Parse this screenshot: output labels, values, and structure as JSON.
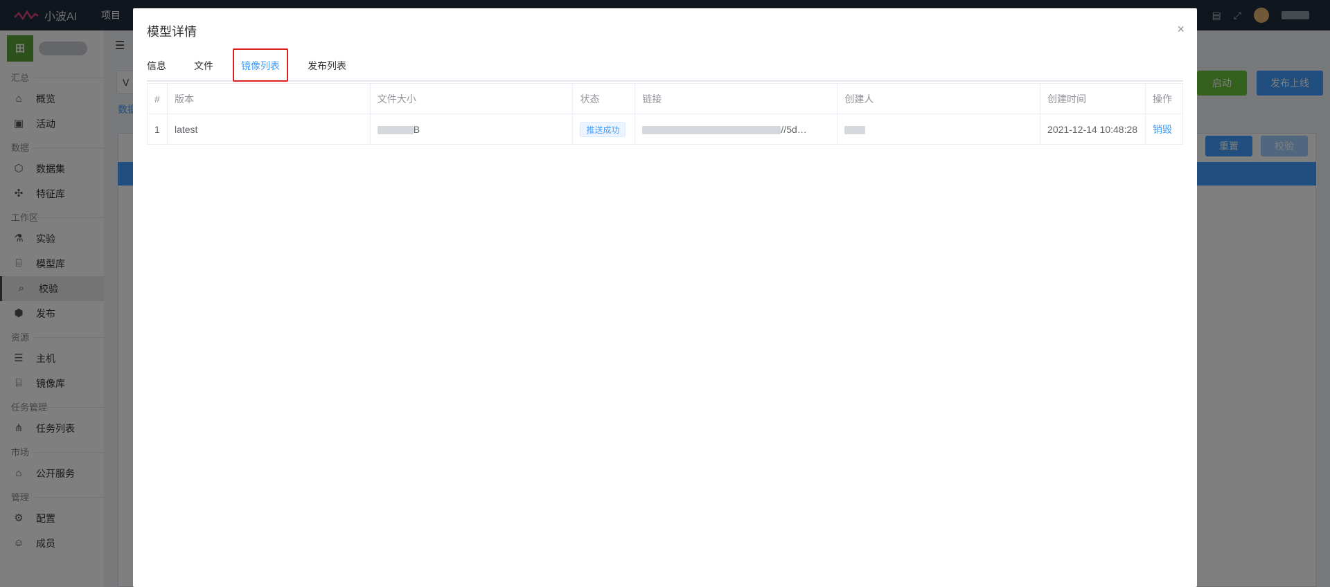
{
  "topbar": {
    "brand": "小波AI",
    "menu_project": "项目"
  },
  "sidebar": {
    "project_icon_text": "田",
    "sections": {
      "summary": "汇总",
      "data": "数据",
      "workspace": "工作区",
      "resources": "资源",
      "tasks": "任务管理",
      "market": "市场",
      "manage": "管理"
    },
    "items": {
      "overview": "概览",
      "activity": "活动",
      "dataset": "数据集",
      "feature_store": "特征库",
      "experiment": "实验",
      "model_repo": "模型库",
      "validate": "校验",
      "publish": "发布",
      "host": "主机",
      "image_repo": "镜像库",
      "task_list": "任务列表",
      "public_service": "公开服务",
      "config": "配置",
      "members": "成员"
    }
  },
  "background": {
    "start_label": "启动",
    "publish_online_label": "发布上线",
    "reset_label": "重置",
    "validate_label": "校验",
    "partial_tab": "数据",
    "partial_input": "V"
  },
  "modal": {
    "title": "模型详情",
    "close_icon": "×",
    "tabs": [
      "信息",
      "文件",
      "镜像列表",
      "发布列表"
    ],
    "active_tab_index": 2,
    "table": {
      "headers": [
        "#",
        "版本",
        "文件大小",
        "状态",
        "链接",
        "创建人",
        "创建时间",
        "操作"
      ],
      "rows": [
        {
          "index": "1",
          "version": "latest",
          "file_size_suffix": "B",
          "status": "推送成功",
          "link_suffix": "//5d…",
          "created_at": "2021-12-14 10:48:28",
          "action": "销毁"
        }
      ]
    }
  },
  "colors": {
    "accent": "#409eff",
    "success": "#67c23a",
    "highlight": "#e02020"
  }
}
